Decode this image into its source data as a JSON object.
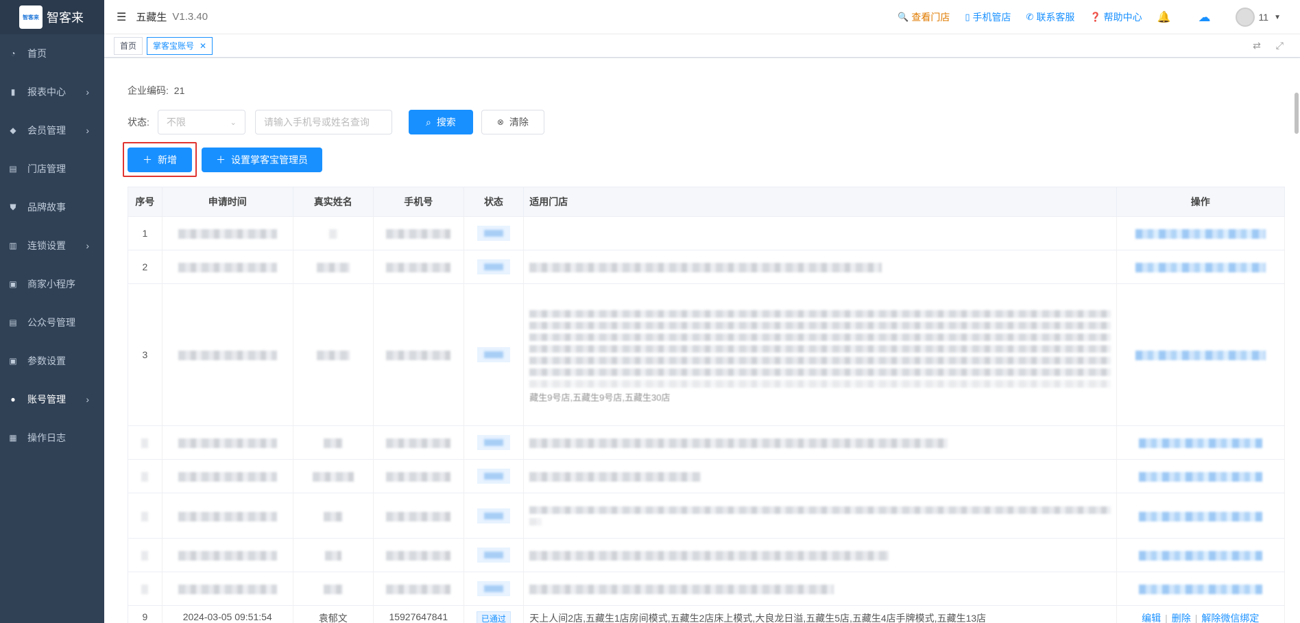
{
  "sidebar": {
    "logo_mark_text": "智客来",
    "logo_text": "智客来",
    "items": [
      {
        "label": "首页",
        "icon": "dashboard-icon",
        "has_arrow": false
      },
      {
        "label": "报表中心",
        "icon": "bar-chart-icon",
        "has_arrow": true
      },
      {
        "label": "会员管理",
        "icon": "diamond-icon",
        "has_arrow": true
      },
      {
        "label": "门店管理",
        "icon": "store-icon",
        "has_arrow": false
      },
      {
        "label": "品牌故事",
        "icon": "shield-icon",
        "has_arrow": false
      },
      {
        "label": "连锁设置",
        "icon": "folder-icon",
        "has_arrow": true
      },
      {
        "label": "商家小程序",
        "icon": "briefcase-icon",
        "has_arrow": false
      },
      {
        "label": "公众号管理",
        "icon": "store-icon",
        "has_arrow": false
      },
      {
        "label": "参数设置",
        "icon": "briefcase-icon",
        "has_arrow": false
      },
      {
        "label": "账号管理",
        "icon": "user-icon",
        "has_arrow": true
      },
      {
        "label": "操作日志",
        "icon": "document-icon",
        "has_arrow": false
      }
    ]
  },
  "header": {
    "app_name": "五藏生",
    "version": "V1.3.40",
    "links": {
      "view_store": "查看门店",
      "mobile_store": "手机管店",
      "contact": "联系客服",
      "help": "帮助中心"
    },
    "user": "11"
  },
  "tabs": {
    "home": "首页",
    "current": "掌客宝账号"
  },
  "main": {
    "company_code_label": "企业编码:",
    "company_code": "21",
    "status_label": "状态:",
    "status_select_placeholder": "不限",
    "search_placeholder": "请输入手机号或姓名查询",
    "search_button": "搜索",
    "clear_button": "清除",
    "add_button": "新增",
    "set_admin_button": "设置掌客宝管理员"
  },
  "table": {
    "headers": [
      "序号",
      "申请时间",
      "真实姓名",
      "手机号",
      "状态",
      "适用门店",
      "操作"
    ],
    "rows": [
      {
        "index": "1"
      },
      {
        "index": "2"
      },
      {
        "index": "3",
        "store_tail": "藏生9号店,五藏生9号店,五藏生30店"
      },
      {
        "index": ""
      },
      {
        "index": ""
      },
      {
        "index": ""
      },
      {
        "index": ""
      },
      {
        "index": ""
      },
      {
        "index": "9",
        "time": "2024-03-05 09:51:54",
        "name": "袁郁文",
        "phone": "15927647841",
        "status": "已通过",
        "stores": "天上人间2店,五藏生1店房间模式,五藏生2店床上模式,大良龙日溢,五藏生5店,五藏生4店手牌模式,五藏生13店",
        "ops": [
          "编辑",
          "删除",
          "解除微信绑定"
        ]
      }
    ]
  },
  "colors": {
    "sidebar_bg": "#304156",
    "primary": "#1890ff",
    "accent_orange": "#e07b00",
    "highlight_red": "#e0332f"
  }
}
